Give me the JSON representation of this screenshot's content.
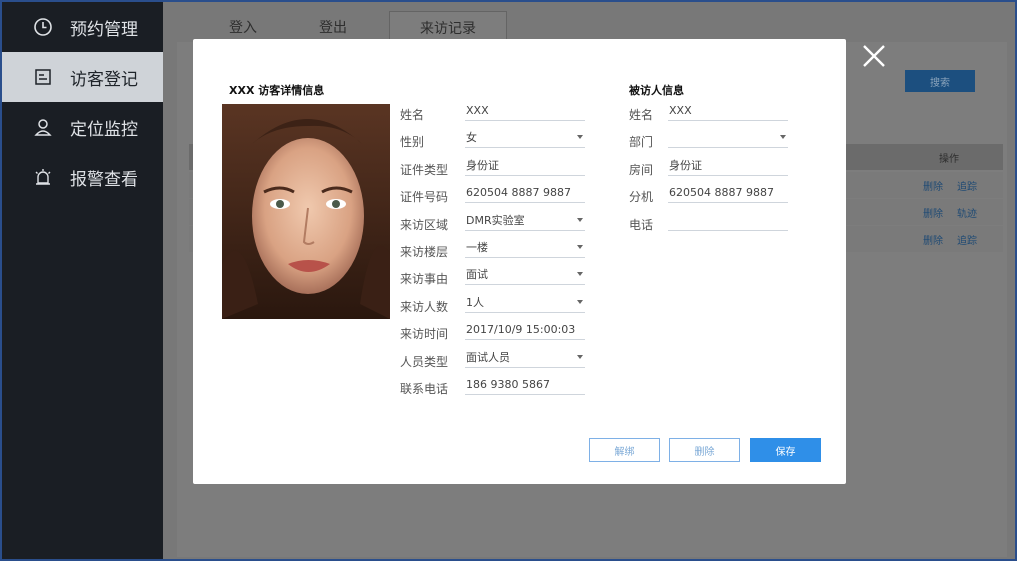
{
  "sidebar": {
    "items": [
      {
        "label": "预约管理",
        "icon": "clock-icon"
      },
      {
        "label": "访客登记",
        "icon": "register-doc-icon",
        "active": true
      },
      {
        "label": "定位监控",
        "icon": "person-location-icon"
      },
      {
        "label": "报警查看",
        "icon": "alarm-light-icon"
      }
    ]
  },
  "tabs": [
    "登入",
    "登出",
    "来访记录"
  ],
  "background": {
    "search_label": "搜索",
    "ops_header": "操作",
    "rows": [
      [
        "删除",
        "追踪"
      ],
      [
        "删除",
        "轨迹"
      ],
      [
        "删除",
        "追踪"
      ]
    ]
  },
  "modal": {
    "visitor_title": "XXX 访客详情信息",
    "host_title": "被访人信息",
    "visitor_fields": [
      {
        "label": "姓名",
        "value": "XXX",
        "dropdown": false
      },
      {
        "label": "性别",
        "value": "女",
        "dropdown": true
      },
      {
        "label": "证件类型",
        "value": "身份证",
        "dropdown": false
      },
      {
        "label": "证件号码",
        "value": "620504 8887 9887",
        "dropdown": false
      },
      {
        "label": "来访区域",
        "value": "DMR实验室",
        "dropdown": true
      },
      {
        "label": "来访楼层",
        "value": "一楼",
        "dropdown": true
      },
      {
        "label": "来访事由",
        "value": "面试",
        "dropdown": true
      },
      {
        "label": "来访人数",
        "value": "1人",
        "dropdown": true
      },
      {
        "label": "来访时间",
        "value": "2017/10/9 15:00:03",
        "dropdown": false
      },
      {
        "label": "人员类型",
        "value": "面试人员",
        "dropdown": true
      },
      {
        "label": "联系电话",
        "value": "186 9380 5867",
        "dropdown": false
      }
    ],
    "host_fields": [
      {
        "label": "姓名",
        "value": "XXX",
        "dropdown": false
      },
      {
        "label": "部门",
        "value": "",
        "dropdown": true
      },
      {
        "label": "房间",
        "value": "身份证",
        "dropdown": false
      },
      {
        "label": "分机",
        "value": "620504 8887 9887",
        "dropdown": false
      },
      {
        "label": "电话",
        "value": "",
        "dropdown": false
      }
    ],
    "buttons": {
      "unbind": "解绑",
      "delete": "删除",
      "save": "保存"
    }
  },
  "colors": {
    "sidebar_bg": "#1a1e24",
    "primary": "#2f8fe8",
    "frame": "#2a4e8c"
  }
}
